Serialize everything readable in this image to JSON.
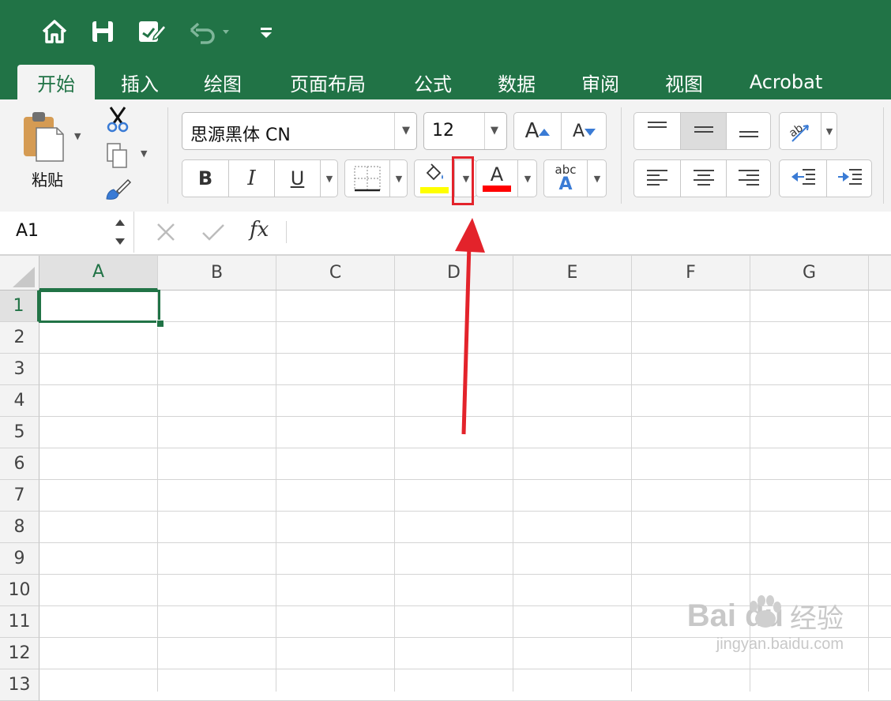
{
  "quick_access": {
    "icons": [
      "home-icon",
      "save-icon",
      "edit-document-icon",
      "undo-icon",
      "customize-toolbar-icon"
    ]
  },
  "tabs": [
    {
      "label": "开始",
      "active": true
    },
    {
      "label": "插入"
    },
    {
      "label": "绘图"
    },
    {
      "label": "页面布局"
    },
    {
      "label": "公式"
    },
    {
      "label": "数据"
    },
    {
      "label": "审阅"
    },
    {
      "label": "视图"
    },
    {
      "label": "Acrobat"
    }
  ],
  "ribbon": {
    "paste_label": "粘贴",
    "font_name": "思源黑体 CN",
    "font_size": "12",
    "bold": "B",
    "italic": "I",
    "underline": "U",
    "grow_font": "A",
    "shrink_font": "A",
    "font_color_letter": "A",
    "phonetic_top": "abc",
    "phonetic_bottom": "A",
    "fill_color": "#ffff00",
    "font_color": "#ff0000"
  },
  "formula_bar": {
    "name_box": "A1",
    "fx": "fx",
    "content": ""
  },
  "grid": {
    "columns": [
      "A",
      "B",
      "C",
      "D",
      "E",
      "F",
      "G"
    ],
    "rows": [
      "1",
      "2",
      "3",
      "4",
      "5",
      "6",
      "7",
      "8",
      "9",
      "10",
      "11",
      "12",
      "13"
    ],
    "selected_cell": "A1"
  },
  "watermark": {
    "brand": "Bai  du",
    "brand_cn": "经验",
    "url": "jingyan.baidu.com"
  },
  "colors": {
    "accent": "#217346",
    "annotation": "#e3232b"
  }
}
